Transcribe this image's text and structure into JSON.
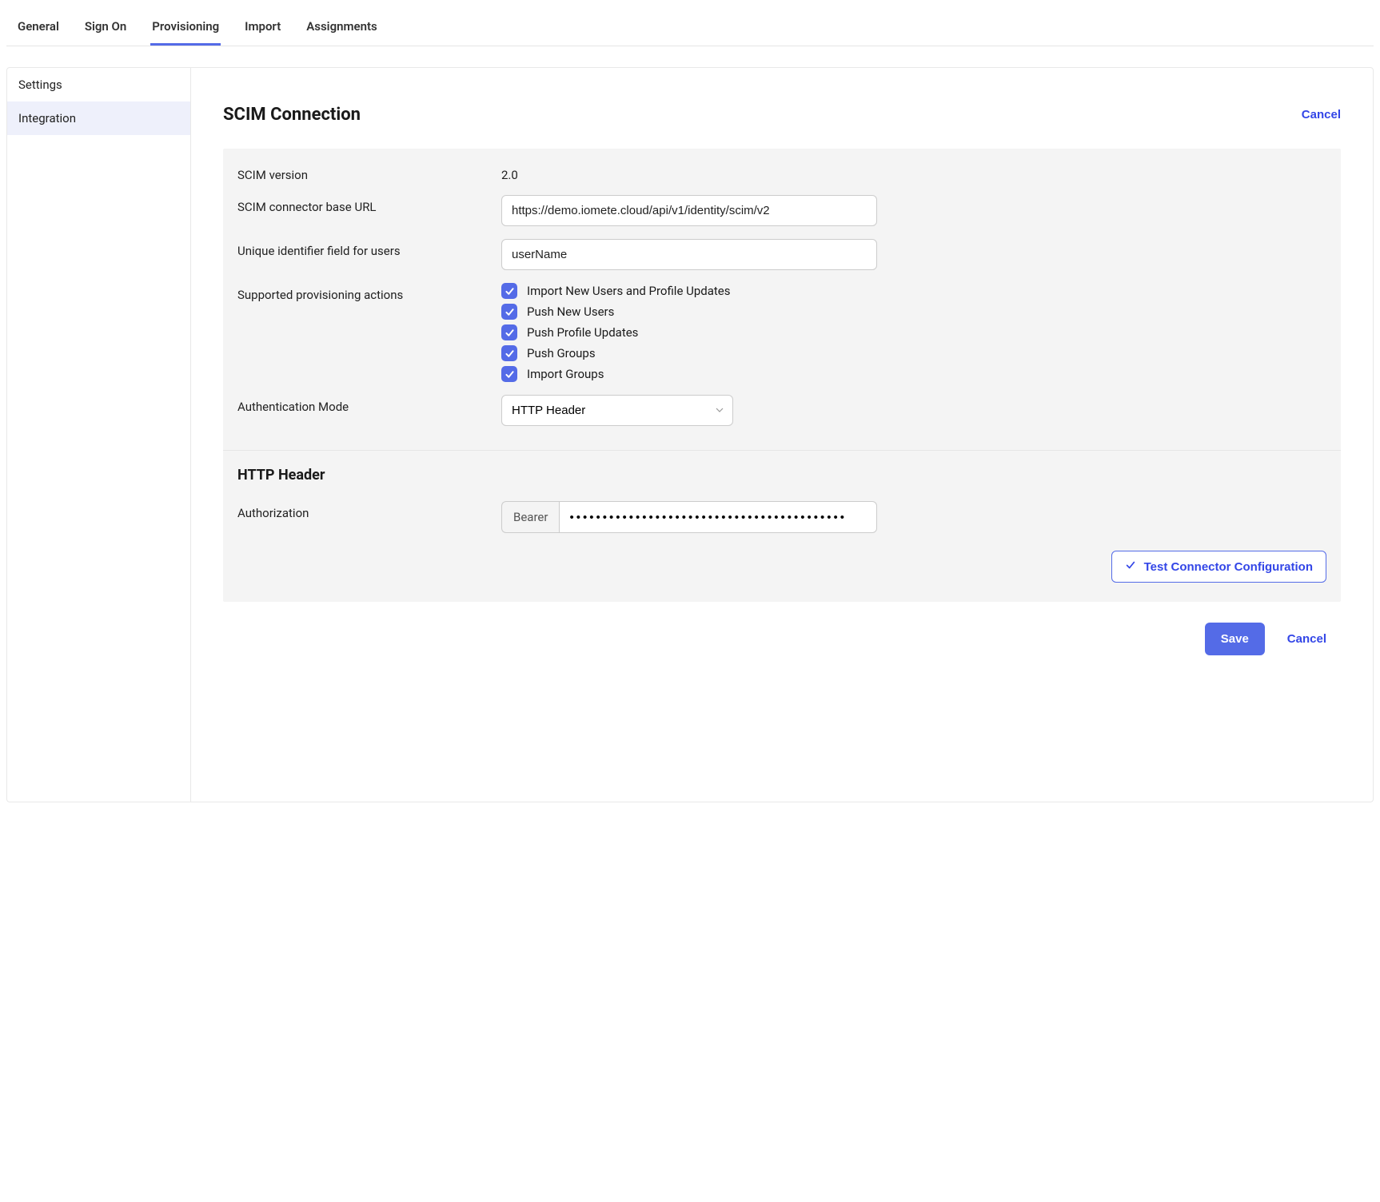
{
  "tabs": [
    {
      "label": "General",
      "active": false
    },
    {
      "label": "Sign On",
      "active": false
    },
    {
      "label": "Provisioning",
      "active": true
    },
    {
      "label": "Import",
      "active": false
    },
    {
      "label": "Assignments",
      "active": false
    }
  ],
  "sidebar": {
    "items": [
      {
        "label": "Settings",
        "selected": false
      },
      {
        "label": "Integration",
        "selected": true
      }
    ]
  },
  "header": {
    "title": "SCIM Connection",
    "cancel": "Cancel"
  },
  "form": {
    "scim_version_label": "SCIM version",
    "scim_version_value": "2.0",
    "base_url_label": "SCIM connector base URL",
    "base_url_value": "https://demo.iomete.cloud/api/v1/identity/scim/v2",
    "uid_label": "Unique identifier field for users",
    "uid_value": "userName",
    "actions_label": "Supported provisioning actions",
    "actions": [
      "Import New Users and Profile Updates",
      "Push New Users",
      "Push Profile Updates",
      "Push Groups",
      "Import Groups"
    ],
    "auth_mode_label": "Authentication Mode",
    "auth_mode_value": "HTTP Header"
  },
  "http_header": {
    "title": "HTTP Header",
    "auth_label": "Authorization",
    "addon": "Bearer",
    "token_mask": "••••••••••••••••••••••••••••••••••••••••••"
  },
  "buttons": {
    "test": "Test Connector Configuration",
    "save": "Save",
    "cancel": "Cancel"
  }
}
